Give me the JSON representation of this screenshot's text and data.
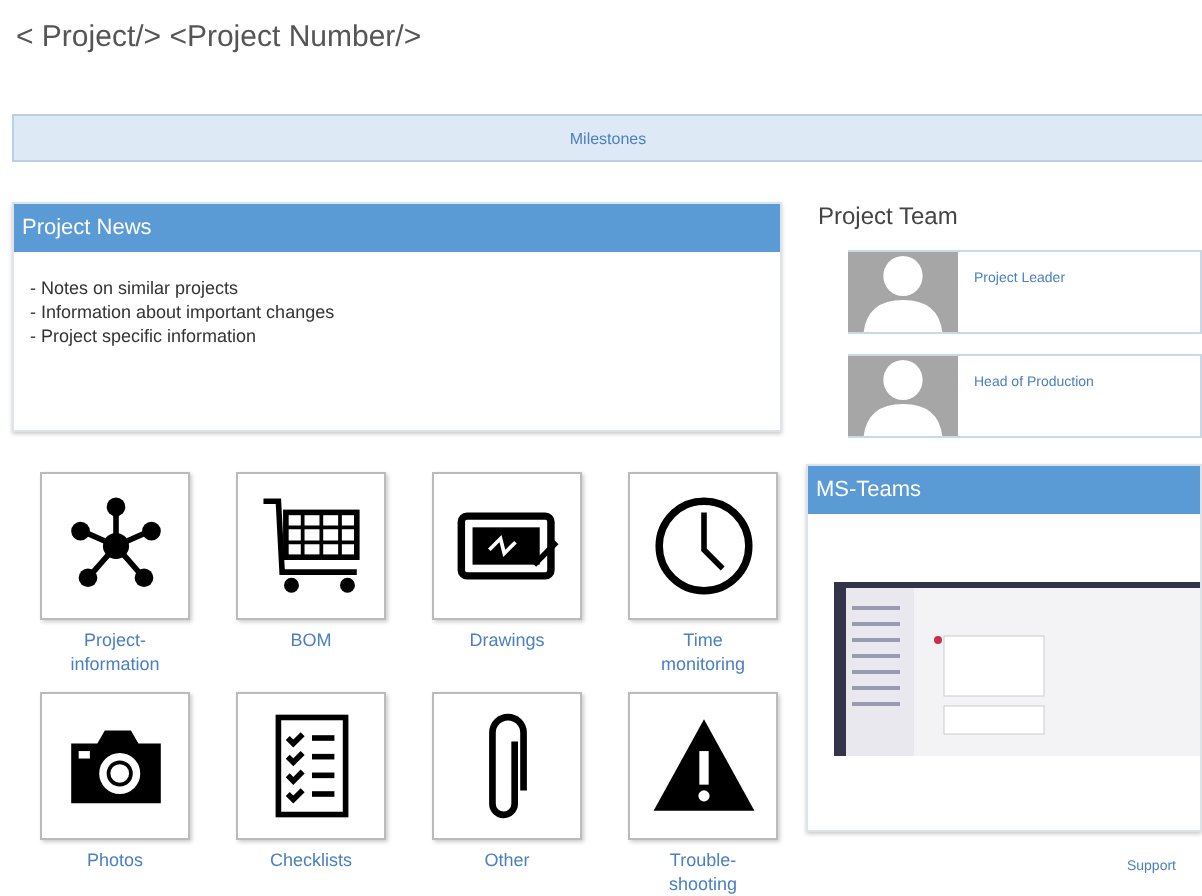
{
  "page_title": "< Project/> <Project Number/>",
  "milestones": {
    "label": "Milestones"
  },
  "project_news": {
    "title": "Project News",
    "items": [
      "- Notes on similar projects",
      "- Information about important changes",
      "- Project specific information"
    ]
  },
  "project_team": {
    "title": "Project Team",
    "members": [
      {
        "role": "Project Leader"
      },
      {
        "role": "Head of Production"
      }
    ]
  },
  "tiles": [
    {
      "kind": "network",
      "label": "Project-information"
    },
    {
      "kind": "cart",
      "label": "BOM"
    },
    {
      "kind": "drawing",
      "label": "Drawings"
    },
    {
      "kind": "clock",
      "label": "Time monitoring"
    },
    {
      "kind": "camera",
      "label": "Photos"
    },
    {
      "kind": "checklist",
      "label": "Checklists"
    },
    {
      "kind": "paperclip",
      "label": "Other"
    },
    {
      "kind": "warning",
      "label": "Trouble-shooting"
    }
  ],
  "ms_teams": {
    "title": "MS-Teams"
  },
  "support_link": "Support"
}
